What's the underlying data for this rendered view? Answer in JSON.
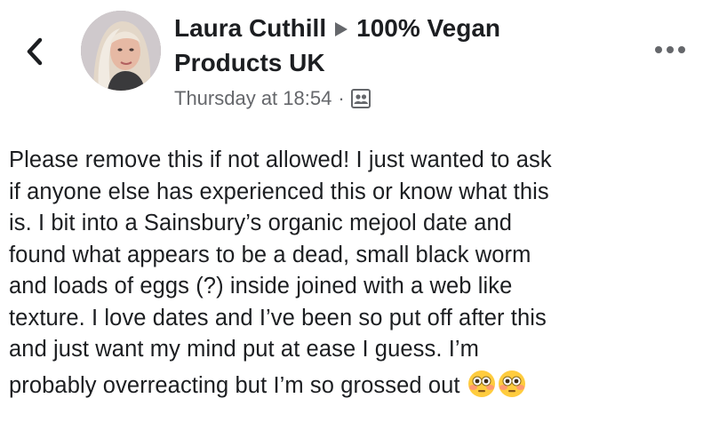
{
  "header": {
    "author_name": "Laura Cuthill",
    "group_name_line1": "100% Vegan",
    "group_name_line2": "Products UK",
    "timestamp": "Thursday at 18:54",
    "separator": "·"
  },
  "icons": {
    "back": "chevron-left-icon",
    "arrow": "right-triangle-icon",
    "audience": "group-members-icon",
    "more": "more-options-icon",
    "emoji": "flushed-face-icon"
  },
  "post": {
    "lines": [
      "Please remove this if not allowed! I just wanted to ask",
      "if anyone else has experienced this or know what this",
      "is. I bit into a Sainsbury’s organic mejool date and",
      "found what appears to be a dead, small black worm",
      "and loads of eggs (?) inside joined with a web like",
      "texture. I love dates and I’ve been so put off after this",
      "and just want my mind put at ease I guess. I’m",
      "probably overreacting but I’m so grossed out"
    ],
    "emoji_count": 2
  }
}
